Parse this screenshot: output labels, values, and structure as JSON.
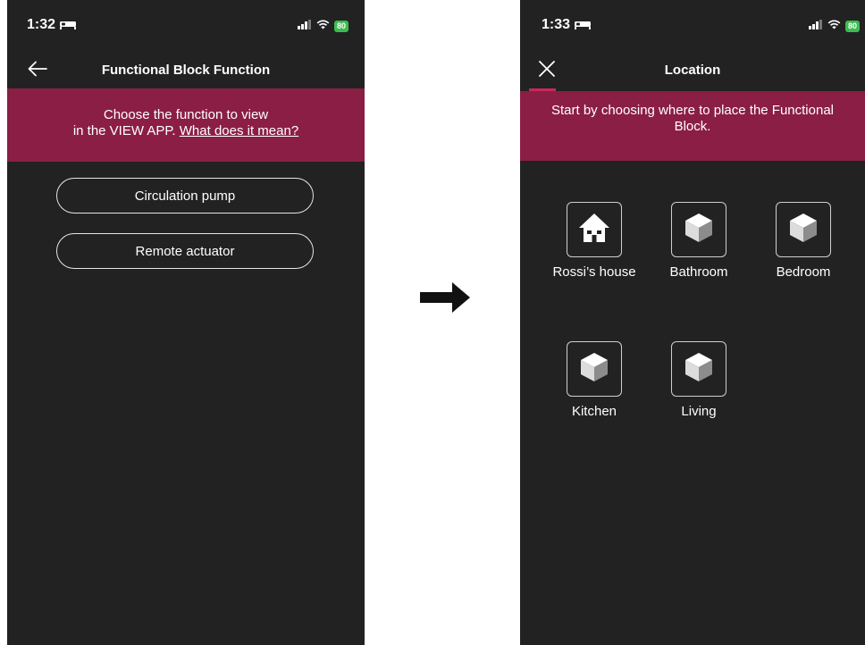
{
  "screen_left": {
    "status": {
      "time": "1:32",
      "battery": "80"
    },
    "nav": {
      "title": "Functional Block Function"
    },
    "banner": {
      "line1": "Choose the function to view",
      "line2_prefix": "in the VIEW APP. ",
      "link": "What does it mean?"
    },
    "options": [
      "Circulation pump",
      "Remote actuator"
    ]
  },
  "screen_right": {
    "status": {
      "time": "1:33",
      "battery": "80"
    },
    "nav": {
      "title": "Location"
    },
    "banner": {
      "text": "Start by choosing where to place the Functional Block."
    },
    "locations": [
      {
        "label": "Rossi’s house",
        "icon": "house-icon"
      },
      {
        "label": "Bathroom",
        "icon": "cube-icon"
      },
      {
        "label": "Bedroom",
        "icon": "cube-icon"
      },
      {
        "label": "Kitchen",
        "icon": "cube-icon"
      },
      {
        "label": "Living",
        "icon": "cube-icon"
      }
    ]
  },
  "colors": {
    "background": "#222222",
    "banner": "#8b1e45",
    "accent": "#c8285a",
    "battery": "#3dbb4f"
  },
  "transition_icon": "right-arrow-icon"
}
